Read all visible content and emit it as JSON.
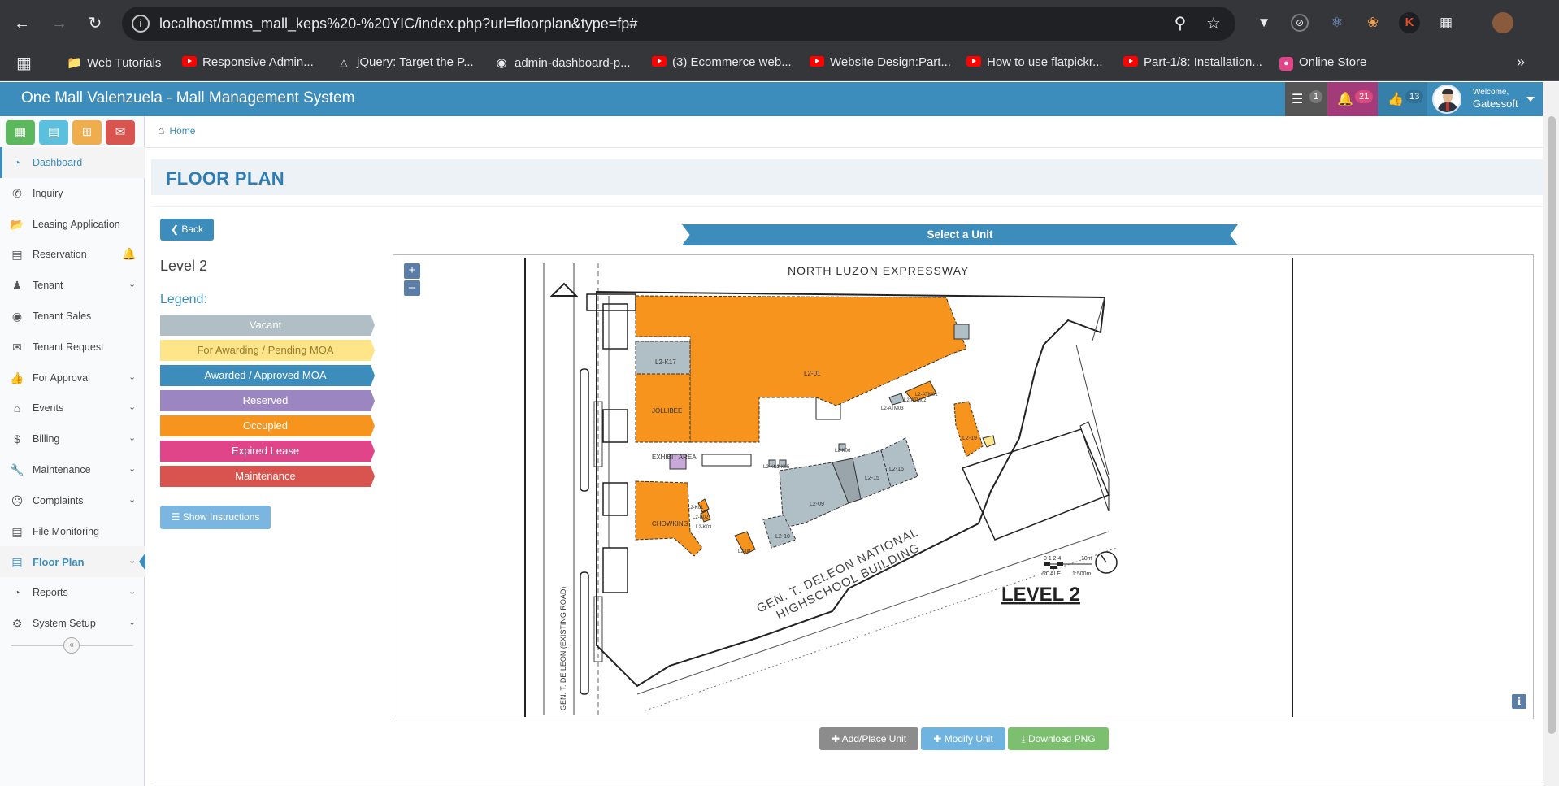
{
  "browser": {
    "url": "localhost/mms_mall_keps%20-%20YIC/index.php?url=floorplan&type=fp#",
    "bookmarks": [
      {
        "label": "Web Tutorials",
        "icon": "folder-icon"
      },
      {
        "label": "Responsive Admin...",
        "icon": "youtube-icon"
      },
      {
        "label": "jQuery: Target the P...",
        "icon": "angular-icon"
      },
      {
        "label": "admin-dashboard-p...",
        "icon": "github-icon"
      },
      {
        "label": "(3) Ecommerce web...",
        "icon": "youtube-icon"
      },
      {
        "label": "Website Design:Part...",
        "icon": "youtube-icon"
      },
      {
        "label": "How to use flatpickr...",
        "icon": "youtube-icon"
      },
      {
        "label": "Part-1/8: Installation...",
        "icon": "youtube-icon"
      },
      {
        "label": "Online Store",
        "icon": "store-icon"
      }
    ]
  },
  "header": {
    "title": "One Mall Valenzuela - Mall Management System",
    "badges": [
      {
        "icon": "server-icon",
        "count": "1",
        "color": "#555555"
      },
      {
        "icon": "bell-icon",
        "count": "21",
        "color": "#a33a7a"
      },
      {
        "icon": "thumbs-up-icon",
        "count": "13",
        "color": "#3c8dbc"
      }
    ],
    "welcome": "Welcome,",
    "user": "Gatessoft"
  },
  "sidebar": {
    "quick_buttons": [
      {
        "icon": "calendar-icon",
        "color": "#5cb85c"
      },
      {
        "icon": "document-icon",
        "color": "#5bc0de"
      },
      {
        "icon": "calendar-plus-icon",
        "color": "#f0ad4e"
      },
      {
        "icon": "envelope-icon",
        "color": "#d9534f"
      }
    ],
    "items": [
      {
        "label": "Dashboard",
        "icon": "dashboard-icon",
        "chevron": false
      },
      {
        "label": "Inquiry",
        "icon": "phone-icon",
        "chevron": false
      },
      {
        "label": "Leasing Application",
        "icon": "folder-open-icon",
        "chevron": false
      },
      {
        "label": "Reservation",
        "icon": "clipboard-icon",
        "chevron": false
      },
      {
        "label": "Tenant",
        "icon": "users-icon",
        "chevron": true
      },
      {
        "label": "Tenant Sales",
        "icon": "globe-icon",
        "chevron": false
      },
      {
        "label": "Tenant Request",
        "icon": "envelope-icon",
        "chevron": false
      },
      {
        "label": "For Approval",
        "icon": "thumbs-up-icon",
        "chevron": true
      },
      {
        "label": "Events",
        "icon": "bank-icon",
        "chevron": true
      },
      {
        "label": "Billing",
        "icon": "dollar-icon",
        "chevron": true
      },
      {
        "label": "Maintenance",
        "icon": "wrench-icon",
        "chevron": true
      },
      {
        "label": "Complaints",
        "icon": "frown-icon",
        "chevron": true
      },
      {
        "label": "File Monitoring",
        "icon": "file-icon",
        "chevron": false
      },
      {
        "label": "Floor Plan",
        "icon": "map-icon",
        "chevron": true
      },
      {
        "label": "Reports",
        "icon": "pie-chart-icon",
        "chevron": true
      },
      {
        "label": "System Setup",
        "icon": "cogs-icon",
        "chevron": true
      }
    ]
  },
  "breadcrumb": {
    "home": "Home"
  },
  "page": {
    "title": "FLOOR PLAN",
    "back_label": "Back",
    "level_name": "Level 2",
    "legend_title": "Legend:",
    "legend": [
      {
        "label": "Vacant",
        "color": "#b0bec5",
        "text_color": "#ffffff"
      },
      {
        "label": "For Awarding / Pending MOA",
        "color": "#ffe58a",
        "text_color": "#b08d3a"
      },
      {
        "label": "Awarded / Approved MOA",
        "color": "#3c8dbc",
        "text_color": "#ffffff"
      },
      {
        "label": "Reserved",
        "color": "#9b86c2",
        "text_color": "#ffffff"
      },
      {
        "label": "Occupied",
        "color": "#f7941d",
        "text_color": "#ffffff"
      },
      {
        "label": "Expired Lease",
        "color": "#e0458a",
        "text_color": "#ffffff"
      },
      {
        "label": "Maintenance",
        "color": "#d9534f",
        "text_color": "#ffffff"
      }
    ],
    "instructions_label": "Show Instructions",
    "select_unit_label": "Select a Unit",
    "actions": {
      "add": "Add/Place Unit",
      "modify": "Modify Unit",
      "download": "Download PNG"
    }
  },
  "floorplan": {
    "road_top": "NORTH LUZON EXPRESSWAY",
    "road_left": "GEN. T. DE LEON (EXISTING ROAD)",
    "school_line1": "GEN. T. DELEON NATIONAL",
    "school_line2": "HIGHSCHOOL BUILDING",
    "level_label": "LEVEL 2",
    "exhibit": "EXHIBIT AREA",
    "scale_label": "SCALE",
    "scale_ratio": "1:500m.",
    "scale_ticks": "0 1 2    4",
    "scale_end": "10m",
    "units": [
      {
        "code": "L2-01",
        "status": "Occupied"
      },
      {
        "code": "L2-K17",
        "status": "Vacant"
      },
      {
        "code": "JOLLIBEE",
        "status": "Occupied"
      },
      {
        "code": "CHOWKING",
        "status": "Occupied"
      },
      {
        "code": "L2-09",
        "status": "Vacant"
      },
      {
        "code": "L2-10",
        "status": "Vacant"
      },
      {
        "code": "L2-15",
        "status": "Vacant"
      },
      {
        "code": "L2-16",
        "status": "Vacant"
      },
      {
        "code": "L2-19",
        "status": "Occupied"
      },
      {
        "code": "L2-08",
        "status": "Occupied"
      },
      {
        "code": "L2-K06",
        "status": "Vacant"
      },
      {
        "code": "L2-K04",
        "status": "Vacant"
      },
      {
        "code": "L2-K05",
        "status": "Vacant"
      },
      {
        "code": "L2-K01",
        "status": "Occupied"
      },
      {
        "code": "L2-K02",
        "status": "Occupied"
      },
      {
        "code": "L2-K03",
        "status": "Occupied"
      },
      {
        "code": "L2-ATM01",
        "status": "Occupied"
      },
      {
        "code": "L2-ATM02",
        "status": "Occupied"
      },
      {
        "code": "L2-ATM03",
        "status": "Vacant"
      }
    ]
  }
}
